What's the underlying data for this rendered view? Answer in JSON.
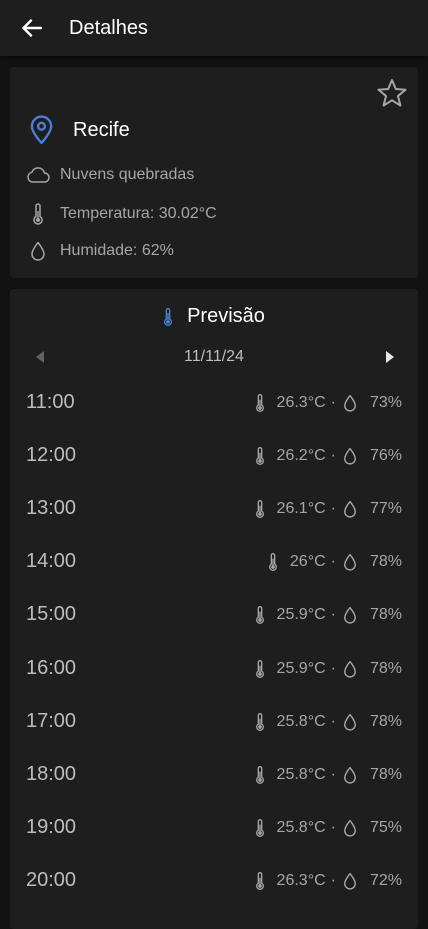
{
  "header": {
    "title": "Detalhes",
    "back_icon": "arrow-left-icon"
  },
  "details": {
    "city": "Recife",
    "condition": "Nuvens quebradas",
    "temperature": "Temperatura: 30.02°C",
    "humidity": "Humidade: 62%",
    "favorite_icon": "star-outline-icon",
    "pin_color": "#4a7fd6"
  },
  "forecast": {
    "title": "Previsão",
    "date": "11/11/24",
    "separator": "·",
    "hours": [
      {
        "time": "11:00",
        "temp": "26.3°C",
        "hum": "73%"
      },
      {
        "time": "12:00",
        "temp": "26.2°C",
        "hum": "76%"
      },
      {
        "time": "13:00",
        "temp": "26.1°C",
        "hum": "77%"
      },
      {
        "time": "14:00",
        "temp": "26°C",
        "hum": "78%"
      },
      {
        "time": "15:00",
        "temp": "25.9°C",
        "hum": "78%"
      },
      {
        "time": "16:00",
        "temp": "25.9°C",
        "hum": "78%"
      },
      {
        "time": "17:00",
        "temp": "25.8°C",
        "hum": "78%"
      },
      {
        "time": "18:00",
        "temp": "25.8°C",
        "hum": "78%"
      },
      {
        "time": "19:00",
        "temp": "25.8°C",
        "hum": "75%"
      },
      {
        "time": "20:00",
        "temp": "26.3°C",
        "hum": "72%"
      }
    ]
  }
}
